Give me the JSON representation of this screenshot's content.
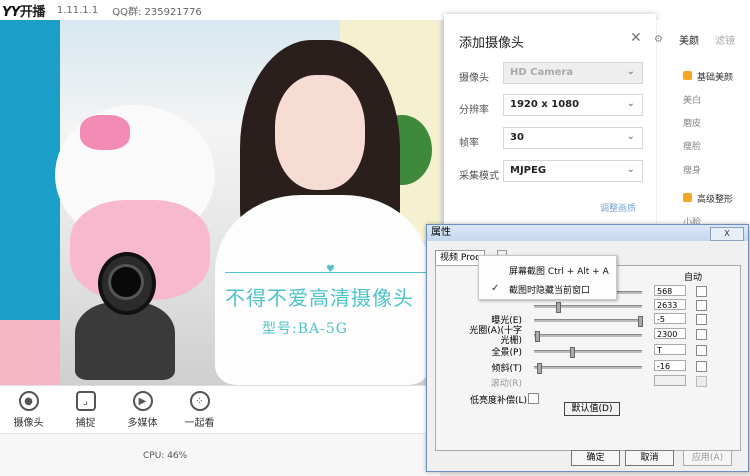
{
  "app": {
    "brand_prefix": "YY",
    "brand_name": "开播",
    "version": "1.11.1.1",
    "qq_group": "QQ群: 235921776"
  },
  "video_overlay": {
    "slogan": "不得不爱高清摄像头",
    "model": "型号:BA-5G"
  },
  "toolbar": [
    {
      "label": "摄像头",
      "icon": "camera-icon"
    },
    {
      "label": "捕捉",
      "icon": "capture-icon"
    },
    {
      "label": "多媒体",
      "icon": "media-icon"
    },
    {
      "label": "一起看",
      "icon": "watch-together-icon"
    }
  ],
  "status": {
    "cpu": "CPU: 46%"
  },
  "add_camera": {
    "title": "添加摄像头",
    "rows": [
      {
        "label": "摄像头",
        "value": "HD Camera",
        "disabled": true
      },
      {
        "label": "分辨率",
        "value": "1920 x 1080",
        "disabled": false
      },
      {
        "label": "帧率",
        "value": "30",
        "disabled": false
      },
      {
        "label": "采集模式",
        "value": "MJPEG",
        "disabled": false
      }
    ],
    "advanced": "调整画质"
  },
  "beauty_panel": {
    "tabs": [
      "美颜",
      "滤镜"
    ],
    "basic_label": "基础美颜",
    "basic_items": [
      "美白",
      "磨皮",
      "瘦脸",
      "瘦身"
    ],
    "advanced_label": "高级整形",
    "advanced_items": [
      "小脸"
    ]
  },
  "properties": {
    "title": "属性",
    "close": "X",
    "tabs": [
      "视频 Proc",
      "      "
    ],
    "auto_header": "自动",
    "rows": [
      {
        "label": "",
        "value": "568",
        "auto": false,
        "disabled": false,
        "thumb": 0.5
      },
      {
        "label": "",
        "value": "2633",
        "auto": false,
        "disabled": false,
        "thumb": 0.2
      },
      {
        "label": "曝光(E)",
        "value": "-5",
        "auto": false,
        "disabled": false,
        "thumb": 0.98
      },
      {
        "label": "光圈(A)(十字光栅)",
        "value": "2300",
        "auto": true,
        "disabled": false,
        "thumb": 0.02
      },
      {
        "label": "全景(P)",
        "value": "T",
        "auto": false,
        "disabled": false,
        "thumb": 0.35
      },
      {
        "label": "倾斜(T)",
        "value": "-16",
        "auto": false,
        "disabled": false,
        "thumb": 0.03
      },
      {
        "label": "滚动(R)",
        "value": "",
        "auto": false,
        "disabled": true,
        "thumb": 0
      }
    ],
    "low_light": "低亮度补偿(L)",
    "default_button": "默认值(D)",
    "ok": "确定",
    "cancel": "取消",
    "apply": "应用(A)"
  },
  "context_menu": {
    "items": [
      "屏幕截图 Ctrl + Alt + A",
      "截图时隐藏当前窗口"
    ],
    "checked_index": 1
  }
}
